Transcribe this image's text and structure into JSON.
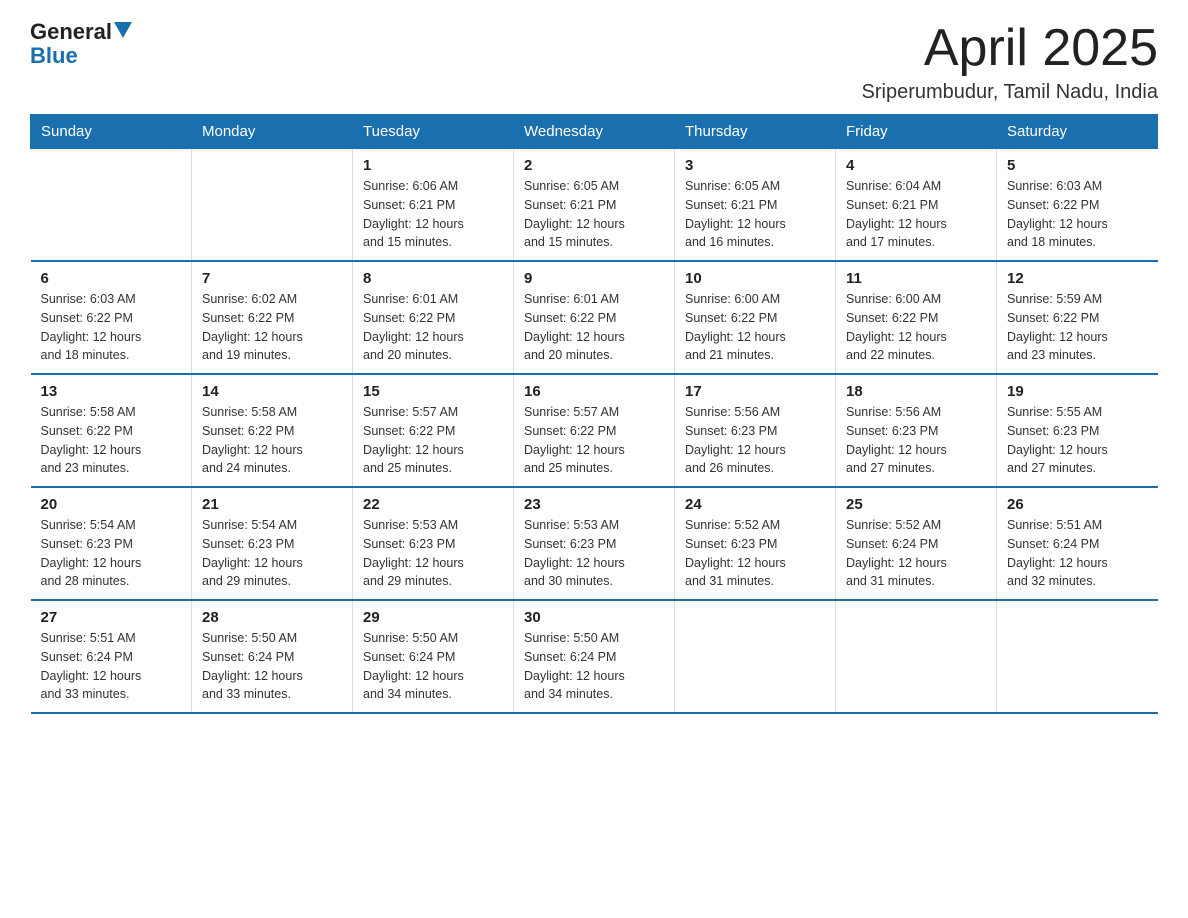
{
  "logo": {
    "text_general": "General",
    "text_blue": "Blue"
  },
  "header": {
    "month_year": "April 2025",
    "location": "Sriperumbudur, Tamil Nadu, India"
  },
  "weekdays": [
    "Sunday",
    "Monday",
    "Tuesday",
    "Wednesday",
    "Thursday",
    "Friday",
    "Saturday"
  ],
  "weeks": [
    [
      {
        "day": "",
        "info": ""
      },
      {
        "day": "",
        "info": ""
      },
      {
        "day": "1",
        "info": "Sunrise: 6:06 AM\nSunset: 6:21 PM\nDaylight: 12 hours\nand 15 minutes."
      },
      {
        "day": "2",
        "info": "Sunrise: 6:05 AM\nSunset: 6:21 PM\nDaylight: 12 hours\nand 15 minutes."
      },
      {
        "day": "3",
        "info": "Sunrise: 6:05 AM\nSunset: 6:21 PM\nDaylight: 12 hours\nand 16 minutes."
      },
      {
        "day": "4",
        "info": "Sunrise: 6:04 AM\nSunset: 6:21 PM\nDaylight: 12 hours\nand 17 minutes."
      },
      {
        "day": "5",
        "info": "Sunrise: 6:03 AM\nSunset: 6:22 PM\nDaylight: 12 hours\nand 18 minutes."
      }
    ],
    [
      {
        "day": "6",
        "info": "Sunrise: 6:03 AM\nSunset: 6:22 PM\nDaylight: 12 hours\nand 18 minutes."
      },
      {
        "day": "7",
        "info": "Sunrise: 6:02 AM\nSunset: 6:22 PM\nDaylight: 12 hours\nand 19 minutes."
      },
      {
        "day": "8",
        "info": "Sunrise: 6:01 AM\nSunset: 6:22 PM\nDaylight: 12 hours\nand 20 minutes."
      },
      {
        "day": "9",
        "info": "Sunrise: 6:01 AM\nSunset: 6:22 PM\nDaylight: 12 hours\nand 20 minutes."
      },
      {
        "day": "10",
        "info": "Sunrise: 6:00 AM\nSunset: 6:22 PM\nDaylight: 12 hours\nand 21 minutes."
      },
      {
        "day": "11",
        "info": "Sunrise: 6:00 AM\nSunset: 6:22 PM\nDaylight: 12 hours\nand 22 minutes."
      },
      {
        "day": "12",
        "info": "Sunrise: 5:59 AM\nSunset: 6:22 PM\nDaylight: 12 hours\nand 23 minutes."
      }
    ],
    [
      {
        "day": "13",
        "info": "Sunrise: 5:58 AM\nSunset: 6:22 PM\nDaylight: 12 hours\nand 23 minutes."
      },
      {
        "day": "14",
        "info": "Sunrise: 5:58 AM\nSunset: 6:22 PM\nDaylight: 12 hours\nand 24 minutes."
      },
      {
        "day": "15",
        "info": "Sunrise: 5:57 AM\nSunset: 6:22 PM\nDaylight: 12 hours\nand 25 minutes."
      },
      {
        "day": "16",
        "info": "Sunrise: 5:57 AM\nSunset: 6:22 PM\nDaylight: 12 hours\nand 25 minutes."
      },
      {
        "day": "17",
        "info": "Sunrise: 5:56 AM\nSunset: 6:23 PM\nDaylight: 12 hours\nand 26 minutes."
      },
      {
        "day": "18",
        "info": "Sunrise: 5:56 AM\nSunset: 6:23 PM\nDaylight: 12 hours\nand 27 minutes."
      },
      {
        "day": "19",
        "info": "Sunrise: 5:55 AM\nSunset: 6:23 PM\nDaylight: 12 hours\nand 27 minutes."
      }
    ],
    [
      {
        "day": "20",
        "info": "Sunrise: 5:54 AM\nSunset: 6:23 PM\nDaylight: 12 hours\nand 28 minutes."
      },
      {
        "day": "21",
        "info": "Sunrise: 5:54 AM\nSunset: 6:23 PM\nDaylight: 12 hours\nand 29 minutes."
      },
      {
        "day": "22",
        "info": "Sunrise: 5:53 AM\nSunset: 6:23 PM\nDaylight: 12 hours\nand 29 minutes."
      },
      {
        "day": "23",
        "info": "Sunrise: 5:53 AM\nSunset: 6:23 PM\nDaylight: 12 hours\nand 30 minutes."
      },
      {
        "day": "24",
        "info": "Sunrise: 5:52 AM\nSunset: 6:23 PM\nDaylight: 12 hours\nand 31 minutes."
      },
      {
        "day": "25",
        "info": "Sunrise: 5:52 AM\nSunset: 6:24 PM\nDaylight: 12 hours\nand 31 minutes."
      },
      {
        "day": "26",
        "info": "Sunrise: 5:51 AM\nSunset: 6:24 PM\nDaylight: 12 hours\nand 32 minutes."
      }
    ],
    [
      {
        "day": "27",
        "info": "Sunrise: 5:51 AM\nSunset: 6:24 PM\nDaylight: 12 hours\nand 33 minutes."
      },
      {
        "day": "28",
        "info": "Sunrise: 5:50 AM\nSunset: 6:24 PM\nDaylight: 12 hours\nand 33 minutes."
      },
      {
        "day": "29",
        "info": "Sunrise: 5:50 AM\nSunset: 6:24 PM\nDaylight: 12 hours\nand 34 minutes."
      },
      {
        "day": "30",
        "info": "Sunrise: 5:50 AM\nSunset: 6:24 PM\nDaylight: 12 hours\nand 34 minutes."
      },
      {
        "day": "",
        "info": ""
      },
      {
        "day": "",
        "info": ""
      },
      {
        "day": "",
        "info": ""
      }
    ]
  ]
}
